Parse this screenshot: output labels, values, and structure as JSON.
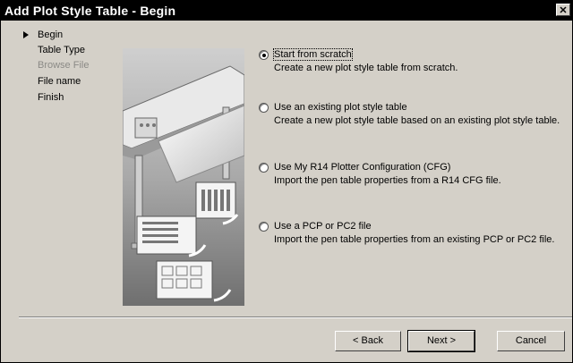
{
  "window": {
    "title": "Add Plot Style Table - Begin",
    "close_glyph": "✕"
  },
  "steps": [
    {
      "label": "Begin",
      "current": true,
      "enabled": true
    },
    {
      "label": "Table Type",
      "current": false,
      "enabled": true
    },
    {
      "label": "Browse File",
      "current": false,
      "enabled": false
    },
    {
      "label": "File name",
      "current": false,
      "enabled": true
    },
    {
      "label": "Finish",
      "current": false,
      "enabled": true
    }
  ],
  "options": [
    {
      "label": "Start from scratch",
      "mnemonic": "S",
      "selected": true,
      "description": "Create a new plot style table from scratch."
    },
    {
      "label": "Use an existing plot style table",
      "mnemonic": "e",
      "selected": false,
      "description": "Create a new plot style table based on an existing plot style table."
    },
    {
      "label": "Use My R14 Plotter Configuration (CFG)",
      "mnemonic": "C",
      "selected": false,
      "description": "Import the pen table properties from a R14 CFG file."
    },
    {
      "label": "Use a PCP or PC2 file",
      "mnemonic": "P",
      "selected": false,
      "description": "Import the pen table properties from an existing PCP or PC2 file."
    }
  ],
  "buttons": {
    "back": "< Back",
    "next": "Next >",
    "cancel": "Cancel"
  },
  "colors": {
    "dialog_bg": "#d4d0c8",
    "titlebar_bg": "#000000",
    "disabled_text": "#8b8a86"
  }
}
